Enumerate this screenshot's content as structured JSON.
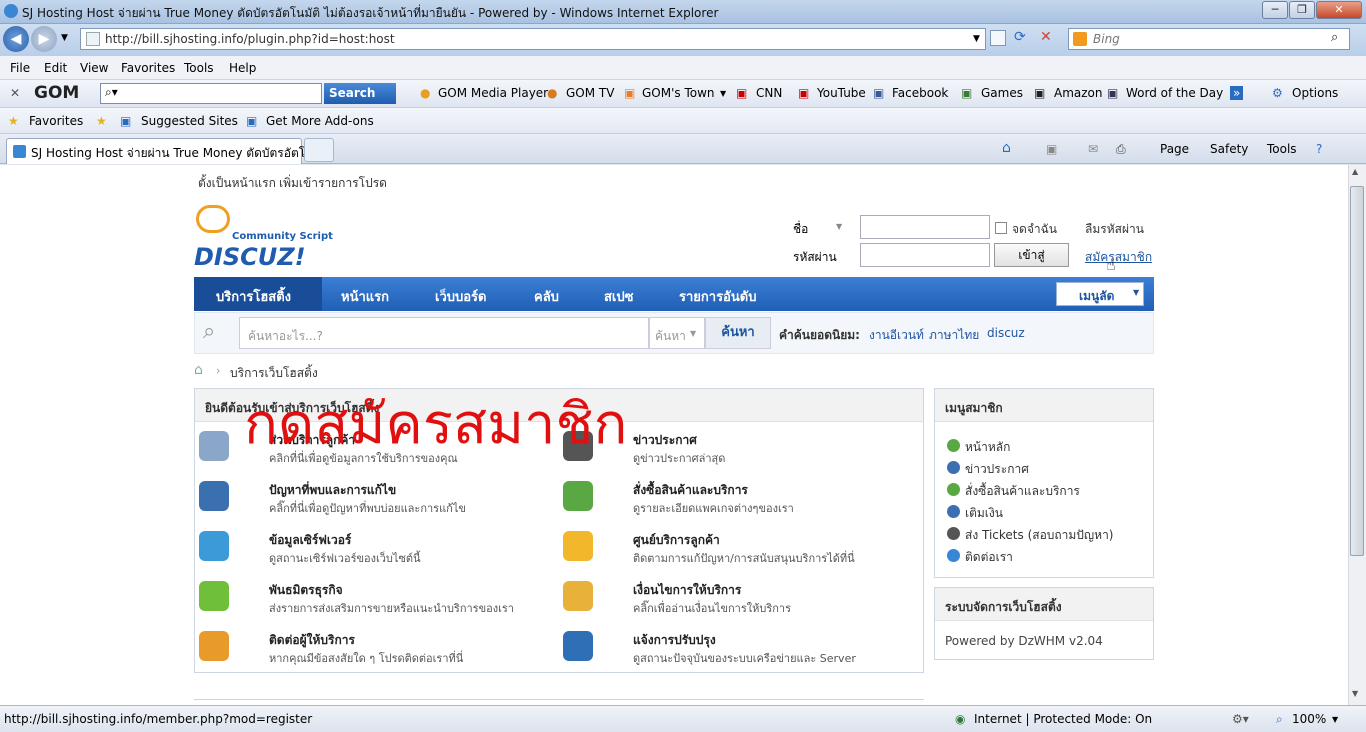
{
  "window": {
    "title": "SJ Hosting Host จ่ายผ่าน True Money ตัดบัตรอัตโนมัติ ไม่ต้องรอเจ้าหน้าที่มายืนยัน - Powered by  - Windows Internet Explorer",
    "min": "─",
    "max": "❐",
    "close": "✕"
  },
  "address": {
    "url": "http://bill.sjhosting.info/plugin.php?id=host:host",
    "search_placeholder": "Bing"
  },
  "menu": [
    "File",
    "Edit",
    "View",
    "Favorites",
    "Tools",
    "Help"
  ],
  "toolbar": {
    "gom_logo": "GOM",
    "search_button": "Search",
    "items": [
      "GOM Media Player",
      "GOM TV",
      "GOM's Town",
      "CNN",
      "YouTube",
      "Facebook",
      "Games",
      "Amazon",
      "Word of the Day"
    ],
    "options": "Options"
  },
  "favorites": {
    "label": "Favorites",
    "items": [
      "Suggested Sites",
      "Get More Add-ons"
    ]
  },
  "tab": {
    "title": "SJ Hosting Host จ่ายผ่าน True Money ตัดบัตรอัตโน...",
    "commands": [
      "Page",
      "Safety",
      "Tools"
    ]
  },
  "site": {
    "toplinks": [
      "ตั้งเป็นหน้าแรก",
      "เพิ่มเข้ารายการโปรด"
    ],
    "logo": {
      "tag": "Community Script",
      "name": "DISCUZ!"
    },
    "login": {
      "user_label": "ชื่อ",
      "pass_label": "รหัสผ่าน",
      "remember": "จดจำฉัน",
      "submit": "เข้าสู่",
      "forgot": "ลืมรหัสผ่าน",
      "register": "สมัครสมาชิก"
    },
    "nav": [
      "บริการโฮสติ้ง",
      "หน้าแรก",
      "เว็บบอร์ด",
      "คลับ",
      "สเปซ",
      "รายการอันดับ"
    ],
    "quickmenu": "เมนูลัด",
    "search": {
      "placeholder": "ค้นหาอะไร...?",
      "type": "ค้นหา",
      "button": "ค้นหา",
      "hot_label": "คำค้นยอดนิยม:",
      "hot": [
        "งานอีเวนท์",
        "ภาษาไทย",
        "discuz"
      ]
    },
    "breadcrumb": "บริการเว็บโฮสติ้ง",
    "welcome": "ยินดีต้อนรับเข้าสู่บริการเว็บโฮสติ้ง",
    "overlay": "กดสมัครสมาชิก",
    "services": [
      {
        "title": "ส่วนบริการลูกค้า",
        "desc": "คลิกที่นี่เพื่อดูข้อมูลการใช้บริการของคุณ",
        "color": "#8aa6c8"
      },
      {
        "title": "ข่าวประกาศ",
        "desc": "ดูข่าวประกาศล่าสุด",
        "color": "#555555"
      },
      {
        "title": "ปัญหาที่พบและการแก้ไข",
        "desc": "คลิ๊กที่นี่เพื่อดูปัญหาที่พบบ่อยและการแก้ไข",
        "color": "#3a6fb0"
      },
      {
        "title": "สั่งซื้อสินค้าและบริการ",
        "desc": "ดูรายละเอียดแพคเกจต่างๆของเรา",
        "color": "#5aa844"
      },
      {
        "title": "ข้อมูลเซิร์ฟเวอร์",
        "desc": "ดูสถานะเซิร์ฟเวอร์ของเว็บไซต์นี้",
        "color": "#3d9ad8"
      },
      {
        "title": "ศูนย์บริการลูกค้า",
        "desc": "ติดตามการแก้ปัญหา/การสนับสนุนบริการได้ที่นี่",
        "color": "#f2b72a"
      },
      {
        "title": "พันธมิตรธุรกิจ",
        "desc": "ส่งรายการส่งเสริมการขายหรือแนะนำบริการของเรา",
        "color": "#6fbf3a"
      },
      {
        "title": "เงื่อนไขการให้บริการ",
        "desc": "คลิ๊กเพื่ออ่านเงื่อนไขการให้บริการ",
        "color": "#e8b23a"
      },
      {
        "title": "ติดต่อผู้ให้บริการ",
        "desc": "หากคุณมีข้อสงสัยใด ๆ โปรดติดต่อเราที่นี่",
        "color": "#e89a2a"
      },
      {
        "title": "แจ้งการปรับปรุง",
        "desc": "ดูสถานะปัจจุบันของระบบเครือข่ายและ Server",
        "color": "#2f6fb6"
      }
    ],
    "member_menu": {
      "title": "เมนูสมาชิก",
      "items": [
        "หน้าหลัก",
        "ข่าวประกาศ",
        "สั่งซื้อสินค้าและบริการ",
        "เติมเงิน",
        "ส่ง Tickets (สอบถามปัญหา)",
        "ติดต่อเรา"
      ]
    },
    "system": {
      "title": "ระบบจัดการเว็บโฮสติ้ง",
      "powered": "Powered by DzWHM v2.04"
    }
  },
  "status": {
    "url": "http://bill.sjhosting.info/member.php?mod=register",
    "zone": "Internet | Protected Mode: On",
    "zoom": "100%"
  }
}
